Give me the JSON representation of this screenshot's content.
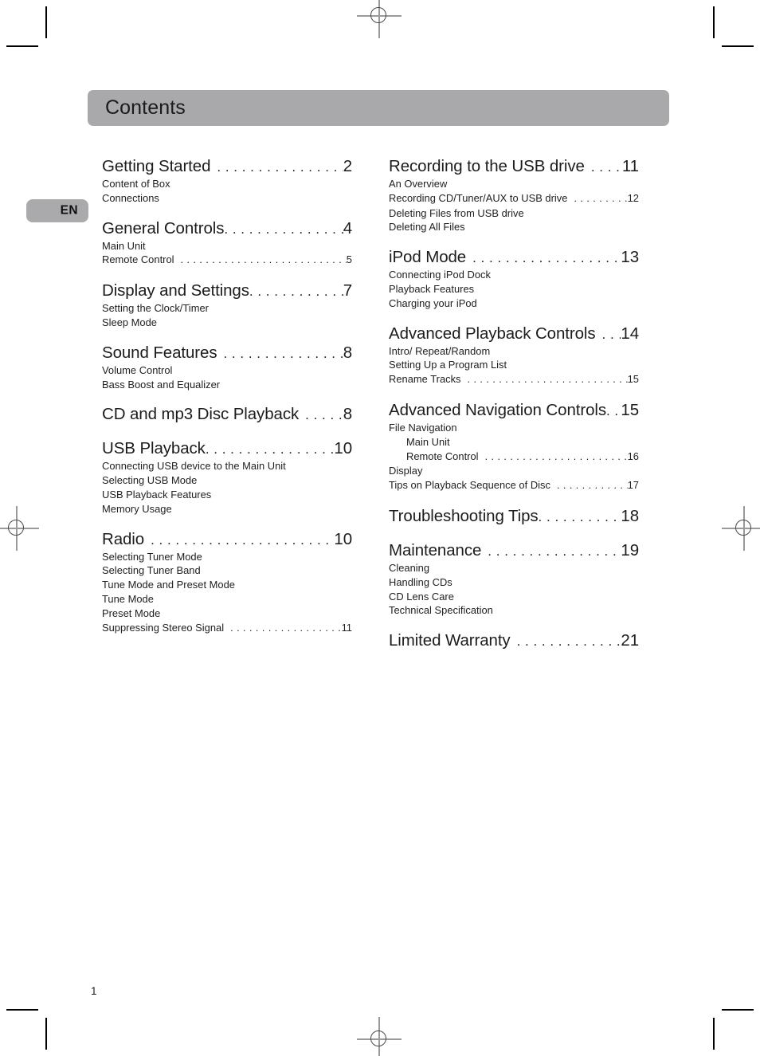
{
  "document": {
    "header_title": "Contents",
    "language_badge": "EN",
    "page_number": "1"
  },
  "toc": {
    "left_column": [
      {
        "title": "Getting Started",
        "page": "2",
        "leader": true,
        "leader_gap": true,
        "items": [
          {
            "label": "Content of Box",
            "page": "",
            "leader": false,
            "indent": false
          },
          {
            "label": "Connections",
            "page": "",
            "leader": false,
            "indent": false
          }
        ]
      },
      {
        "title": "General Controls",
        "page": "4",
        "leader": true,
        "leader_gap": false,
        "items": [
          {
            "label": "Main Unit",
            "page": "",
            "leader": false,
            "indent": false
          },
          {
            "label": "Remote Control",
            "page": "5",
            "leader": true,
            "indent": false
          }
        ]
      },
      {
        "title": "Display and Settings",
        "page": "7",
        "leader": true,
        "leader_gap": false,
        "items": [
          {
            "label": "Setting the Clock/Timer",
            "page": "",
            "leader": false,
            "indent": false
          },
          {
            "label": "Sleep Mode",
            "page": "",
            "leader": false,
            "indent": false
          }
        ]
      },
      {
        "title": "Sound Features",
        "page": "8",
        "leader": true,
        "leader_gap": true,
        "items": [
          {
            "label": "Volume Control",
            "page": "",
            "leader": false,
            "indent": false
          },
          {
            "label": "Bass Boost and Equalizer",
            "page": "",
            "leader": false,
            "indent": false
          }
        ]
      },
      {
        "title": "CD and mp3 Disc Playback",
        "page": "8",
        "leader": true,
        "leader_gap": true,
        "items": []
      },
      {
        "title": "USB Playback",
        "page": "10",
        "leader": true,
        "leader_gap": false,
        "items": [
          {
            "label": "Connecting USB device to the Main Unit",
            "page": "",
            "leader": false,
            "indent": false
          },
          {
            "label": "Selecting USB Mode",
            "page": "",
            "leader": false,
            "indent": false
          },
          {
            "label": "USB Playback Features",
            "page": "",
            "leader": false,
            "indent": false
          },
          {
            "label": "Memory Usage",
            "page": "",
            "leader": false,
            "indent": false
          }
        ]
      },
      {
        "title": "Radio",
        "page": "10",
        "leader": true,
        "leader_gap": true,
        "items": [
          {
            "label": "Selecting Tuner Mode",
            "page": "",
            "leader": false,
            "indent": false
          },
          {
            "label": "Selecting Tuner Band",
            "page": "",
            "leader": false,
            "indent": false
          },
          {
            "label": "Tune Mode and Preset Mode",
            "page": "",
            "leader": false,
            "indent": false
          },
          {
            "label": "Tune Mode",
            "page": "",
            "leader": false,
            "indent": false
          },
          {
            "label": "Preset Mode",
            "page": "",
            "leader": false,
            "indent": false
          },
          {
            "label": "Suppressing Stereo Signal",
            "page": "11",
            "leader": true,
            "indent": false
          }
        ]
      }
    ],
    "right_column": [
      {
        "title": "Recording to the USB drive",
        "page": "11",
        "leader": true,
        "leader_gap": true,
        "items": [
          {
            "label": "An Overview",
            "page": "",
            "leader": false,
            "indent": false
          },
          {
            "label": "Recording CD/Tuner/AUX to USB drive",
            "page": "12",
            "leader": true,
            "indent": false
          },
          {
            "label": "Deleting Files from USB drive",
            "page": "",
            "leader": false,
            "indent": false
          },
          {
            "label": "Deleting All Files",
            "page": "",
            "leader": false,
            "indent": false
          }
        ]
      },
      {
        "title": "iPod Mode",
        "page": "13",
        "leader": true,
        "leader_gap": true,
        "items": [
          {
            "label": "Connecting iPod Dock",
            "page": "",
            "leader": false,
            "indent": false
          },
          {
            "label": "Playback Features",
            "page": "",
            "leader": false,
            "indent": false
          },
          {
            "label": "Charging your iPod",
            "page": "",
            "leader": false,
            "indent": false
          }
        ]
      },
      {
        "title": "Advanced Playback Controls",
        "page": "14",
        "leader": true,
        "leader_gap": true,
        "items": [
          {
            "label": "Intro/ Repeat/Random",
            "page": "",
            "leader": false,
            "indent": false
          },
          {
            "label": "Setting Up a Program List",
            "page": "",
            "leader": false,
            "indent": false
          },
          {
            "label": "Rename Tracks",
            "page": "15",
            "leader": true,
            "indent": false
          }
        ]
      },
      {
        "title": "Advanced Navigation Controls",
        "page": "15",
        "leader": true,
        "leader_gap": false,
        "items": [
          {
            "label": "File Navigation",
            "page": "",
            "leader": false,
            "indent": false
          },
          {
            "label": "Main Unit",
            "page": "",
            "leader": false,
            "indent": true
          },
          {
            "label": "Remote Control",
            "page": "16",
            "leader": true,
            "indent": true
          },
          {
            "label": "Display",
            "page": "",
            "leader": false,
            "indent": false
          },
          {
            "label": "Tips on Playback Sequence of Disc",
            "page": "17",
            "leader": true,
            "indent": false
          }
        ]
      },
      {
        "title": "Troubleshooting Tips",
        "page": "18",
        "leader": true,
        "leader_gap": false,
        "items": []
      },
      {
        "title": "Maintenance",
        "page": "19",
        "leader": true,
        "leader_gap": true,
        "items": [
          {
            "label": "Cleaning",
            "page": "",
            "leader": false,
            "indent": false
          },
          {
            "label": "Handling CDs",
            "page": "",
            "leader": false,
            "indent": false
          },
          {
            "label": "CD Lens Care",
            "page": "",
            "leader": false,
            "indent": false
          },
          {
            "label": "Technical Specification",
            "page": "",
            "leader": false,
            "indent": false
          }
        ]
      },
      {
        "title": "Limited Warranty",
        "page": "21",
        "leader": true,
        "leader_gap": true,
        "items": []
      }
    ]
  },
  "print_marks": {
    "registration_marks": 4,
    "corner_crop_marks": 4,
    "mark_color": "#4a4a4a",
    "band_color": "#a9a9ac"
  }
}
